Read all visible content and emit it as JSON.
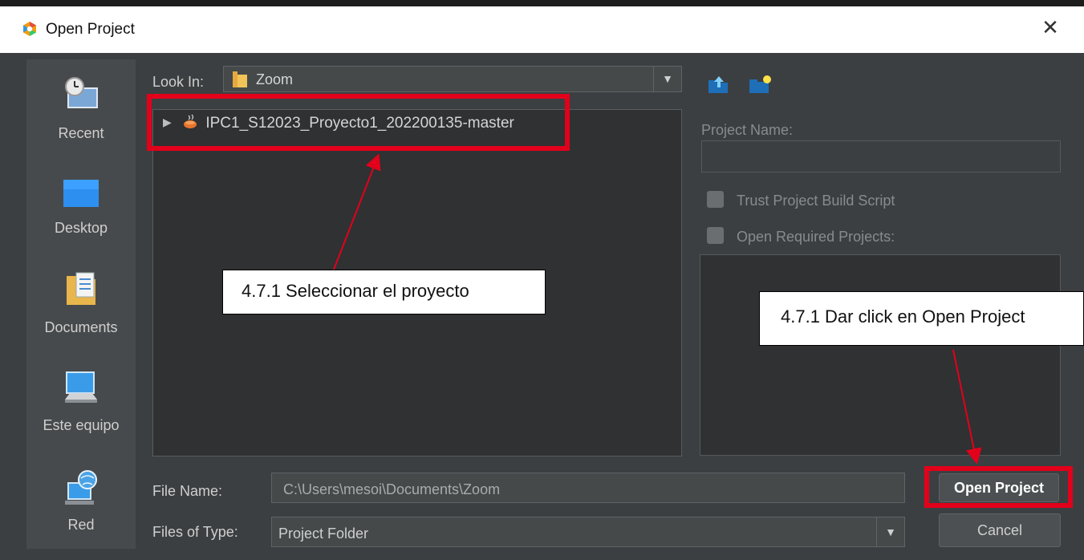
{
  "window": {
    "title": "Open Project",
    "close_glyph": "✕"
  },
  "places": [
    {
      "label": "Recent",
      "icon": "recent-icon"
    },
    {
      "label": "Desktop",
      "icon": "desktop-icon"
    },
    {
      "label": "Documents",
      "icon": "documents-icon"
    },
    {
      "label": "Este equipo",
      "icon": "computer-icon"
    },
    {
      "label": "Red",
      "icon": "network-icon"
    }
  ],
  "lookin": {
    "label": "Look In:",
    "value": "Zoom"
  },
  "toolbar": {
    "up_icon": "up-folder-icon",
    "new_icon": "new-folder-icon"
  },
  "files": [
    {
      "name": "IPC1_S12023_Proyecto1_202200135-master",
      "icon": "java-project-icon"
    }
  ],
  "project_name": {
    "label": "Project Name:",
    "value": ""
  },
  "options": {
    "trust": "Trust Project Build Script",
    "required": "Open Required Projects:"
  },
  "file_name": {
    "label": "File Name:",
    "value": "C:\\Users\\mesoi\\Documents\\Zoom"
  },
  "files_of_type": {
    "label": "Files of Type:",
    "value": "Project Folder"
  },
  "buttons": {
    "open": "Open Project",
    "cancel": "Cancel"
  },
  "annotations": {
    "select": "4.7.1 Seleccionar el proyecto",
    "click": "4.7.1 Dar click en Open Project",
    "color": "#e3001b"
  }
}
